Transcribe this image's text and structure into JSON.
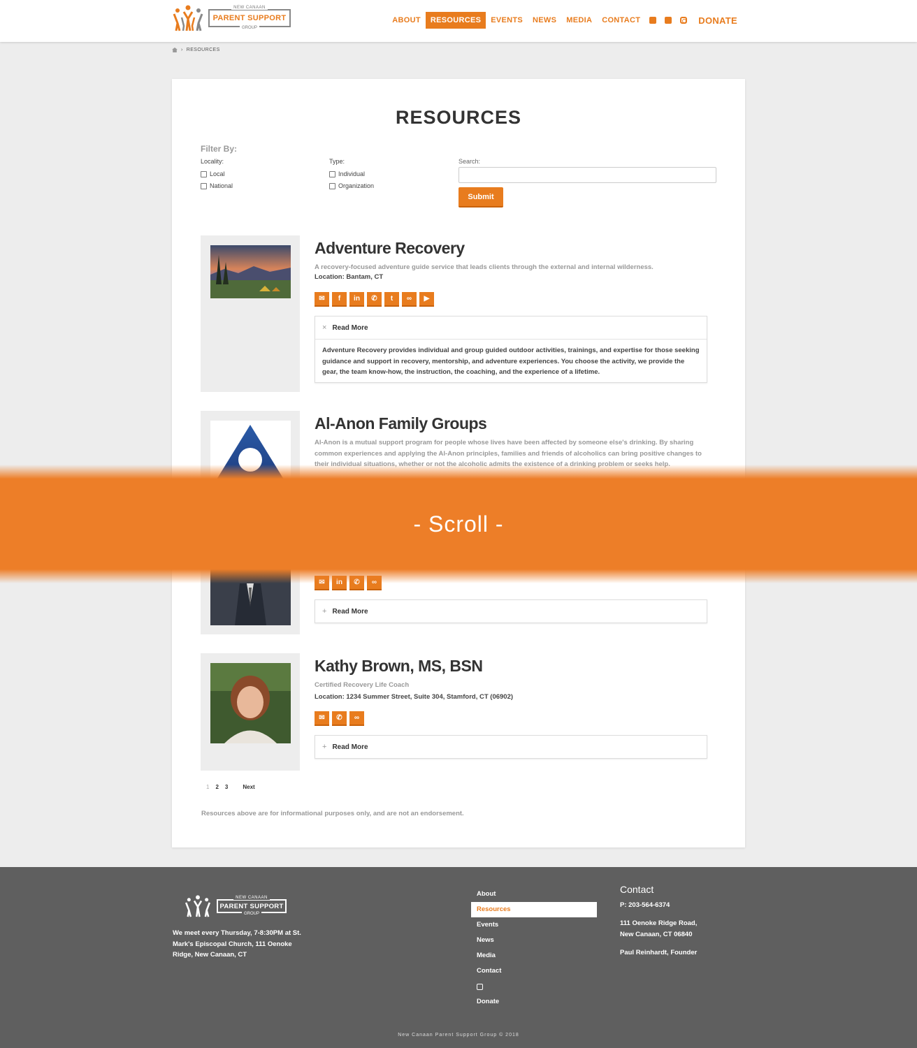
{
  "brand": {
    "line1": "NEW CANAAN",
    "line2": "PARENT SUPPORT",
    "line3": "GROUP",
    "accent_color": "#e87c1e"
  },
  "nav": {
    "items": [
      {
        "label": "ABOUT"
      },
      {
        "label": "RESOURCES",
        "active": true
      },
      {
        "label": "EVENTS"
      },
      {
        "label": "NEWS"
      },
      {
        "label": "MEDIA"
      },
      {
        "label": "CONTACT"
      }
    ],
    "social_icons": [
      "facebook-icon",
      "twitter-icon",
      "instagram-icon"
    ],
    "donate_label": "DONATE"
  },
  "breadcrumb": {
    "home_icon": "home-icon",
    "current": "RESOURCES"
  },
  "page": {
    "title": "RESOURCES"
  },
  "filters": {
    "heading": "Filter By:",
    "locality": {
      "label": "Locality:",
      "options": [
        "Local",
        "National"
      ]
    },
    "type": {
      "label": "Type:",
      "options": [
        "Individual",
        "Organization"
      ]
    },
    "search": {
      "label": "Search:",
      "placeholder": "",
      "value": ""
    },
    "submit_label": "Submit"
  },
  "resources": [
    {
      "name": "Adventure Recovery",
      "description": "A recovery-focused adventure guide service that leads clients through the external and internal wilderness.",
      "location": "Location: Bantam, CT",
      "icons": [
        "envelope-icon",
        "facebook-icon",
        "linkedin-icon",
        "phone-icon",
        "twitter-icon",
        "link-icon",
        "youtube-icon"
      ],
      "read_more": "Read More",
      "read_more_body": "Adventure Recovery provides individual and group guided outdoor activities, trainings, and expertise for those seeking guidance and support in recovery, mentorship, and adventure experiences. You choose the activity, we provide the gear, the team know-how, the instruction, the coaching, and the experience of a lifetime."
    },
    {
      "name": "Al-Anon Family Groups",
      "description": "Al-Anon is a mutual support program for people whose lives have been affected by someone else's drinking. By sharing common experiences and applying the Al-Anon principles, families and friends of alcoholics can bring positive changes to their individual situations, whether or not the alcoholic admits the existence of a drinking problem or seeks help."
    },
    {
      "icons": [
        "envelope-icon",
        "linkedin-icon",
        "phone-icon",
        "link-icon"
      ],
      "read_more": "Read More"
    },
    {
      "name": "Kathy Brown, MS, BSN",
      "description": "Certified Recovery Life Coach",
      "location": "Location: 1234 Summer Street, Suite 304, Stamford, CT (06902)",
      "icons": [
        "envelope-icon",
        "phone-icon",
        "link-icon"
      ],
      "read_more": "Read More"
    }
  ],
  "pagination": {
    "pages": [
      "1",
      "2",
      "3"
    ],
    "current": "1",
    "next_label": "Next"
  },
  "disclaimer": "Resources above are for informational purposes only, and are not an endorsement.",
  "scroll_banner": "- Scroll -",
  "footer": {
    "meeting": "We meet every Thursday, 7-8:30PM at St. Mark's Episcopal Church, 111 Oenoke Ridge, New Canaan, CT",
    "nav": [
      {
        "label": "About"
      },
      {
        "label": "Resources",
        "active": true
      },
      {
        "label": "Events"
      },
      {
        "label": "News"
      },
      {
        "label": "Media"
      },
      {
        "label": "Contact"
      },
      {
        "icon": "instagram-icon"
      },
      {
        "label": "Donate"
      }
    ],
    "contact": {
      "heading": "Contact",
      "phone": "P: 203-564-6374",
      "address1": "111 Oenoke Ridge Road,",
      "address2": "New Canaan, CT 06840",
      "founder": "Paul Reinhardt, Founder"
    },
    "copyright": "New Canaan Parent Support Group © 2018"
  }
}
